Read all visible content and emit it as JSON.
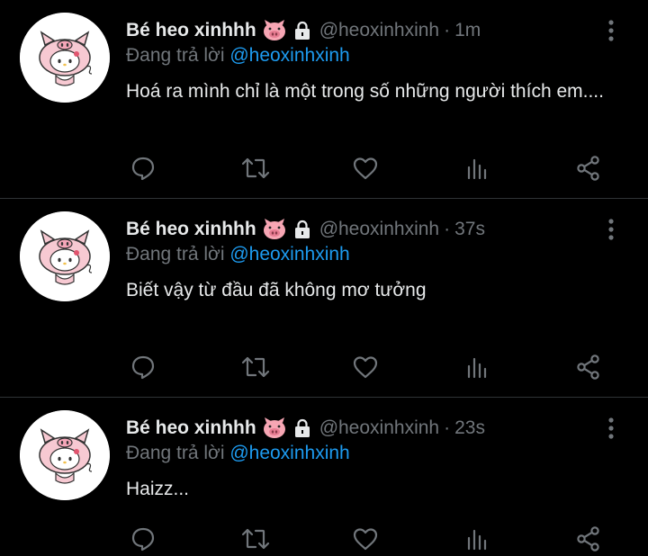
{
  "tweets": [
    {
      "author": {
        "name": "Bé heo xinhhh",
        "handle": "@heoxinhxinh"
      },
      "time": "1m",
      "reply_prefix": "Đang trả lời ",
      "reply_to": "@heoxinhxinh",
      "text": "Hoá ra mình chỉ là một trong số những người thích em...."
    },
    {
      "author": {
        "name": "Bé heo xinhhh",
        "handle": "@heoxinhxinh"
      },
      "time": "37s",
      "reply_prefix": "Đang trả lời ",
      "reply_to": "@heoxinhxinh",
      "text": "Biết vậy từ đầu đã không mơ tưởng"
    },
    {
      "author": {
        "name": "Bé heo xinhhh",
        "handle": "@heoxinhxinh"
      },
      "time": "23s",
      "reply_prefix": "Đang trả lời ",
      "reply_to": "@heoxinhxinh",
      "text": "Haizz..."
    }
  ],
  "separator": "·",
  "icons": {
    "badge": "pig-face-icon",
    "protected": "lock-icon",
    "menu": "more-vertical-icon",
    "actions": [
      "reply-icon",
      "retweet-icon",
      "like-icon",
      "stats-icon",
      "share-icon"
    ]
  },
  "colors": {
    "background": "#000000",
    "text": "#e7e9ea",
    "muted": "#71767b",
    "mention": "#1d9bf0",
    "divider": "#2f3336"
  }
}
